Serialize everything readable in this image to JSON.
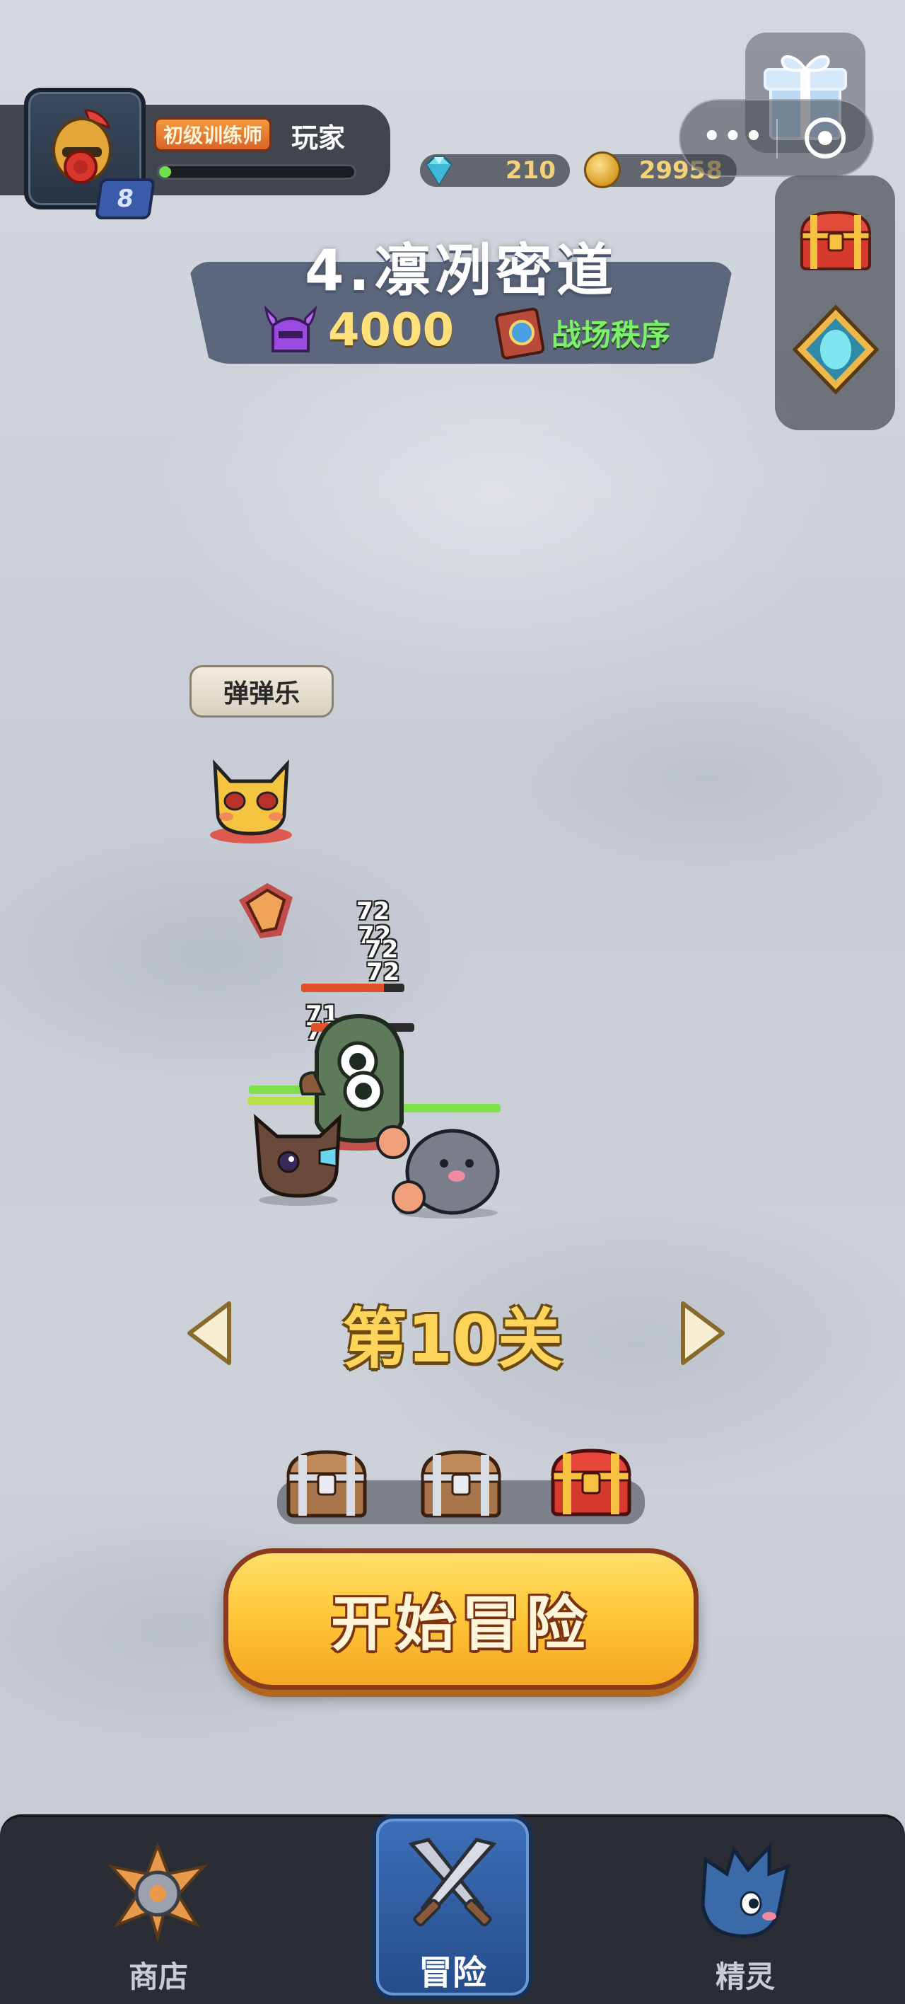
{
  "player": {
    "rank": "初级训练师",
    "name": "玩家",
    "level": "8",
    "xp_progress": 0.06
  },
  "currency": {
    "gems": "210",
    "coins": "29958"
  },
  "stage": {
    "title": "4.凛冽密道",
    "power": "4000",
    "order_label": "战场秩序"
  },
  "battle": {
    "skill_tag": "弹弹乐",
    "damage_numbers": [
      "72",
      "72",
      "72",
      "72",
      "71",
      "71"
    ]
  },
  "level_selector": {
    "label": "第10关"
  },
  "start_button": {
    "label": "开始冒险"
  },
  "nav": {
    "items": [
      {
        "label": "商店",
        "active": false
      },
      {
        "label": "冒险",
        "active": true
      },
      {
        "label": "精灵",
        "active": false
      }
    ]
  },
  "colors": {
    "accent_yellow": "#ffc83a",
    "nav_active": "#3d6fb8",
    "hp_green": "#7ee04a",
    "hp_red": "#e0502a"
  }
}
